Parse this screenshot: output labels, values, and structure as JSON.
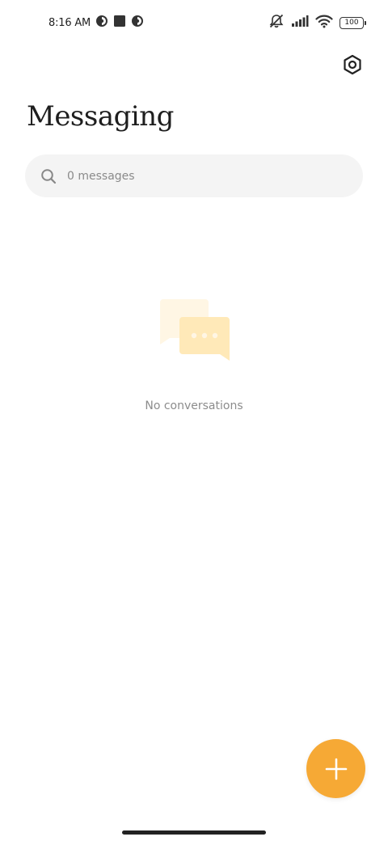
{
  "status_bar": {
    "time": "8:16 AM",
    "battery": "100"
  },
  "header": {
    "title": "Messaging",
    "settings_icon": "settings-hex-icon"
  },
  "search": {
    "placeholder": "0 messages",
    "value": ""
  },
  "empty_state": {
    "text": "No conversations",
    "illustration": "chat-bubbles-icon"
  },
  "fab": {
    "icon": "plus-icon",
    "color": "#f6a935"
  },
  "colors": {
    "accent": "#f6a935",
    "bubble_back": "#fff6e4",
    "bubble_front": "#ffe9b8",
    "search_bg": "#f4f4f4"
  }
}
